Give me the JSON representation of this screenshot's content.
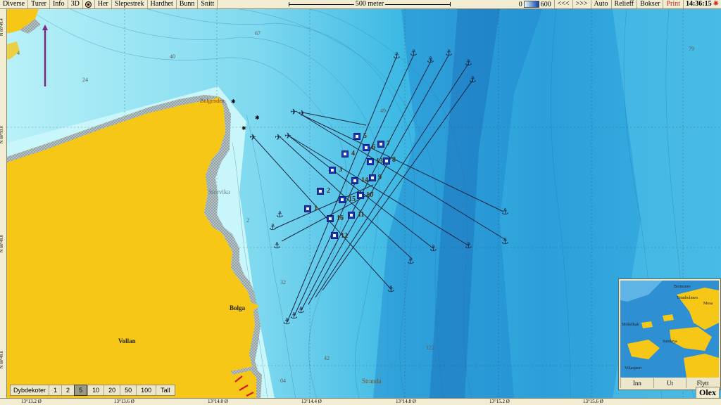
{
  "menu": {
    "items": [
      "Diverse",
      "Turer",
      "Info",
      "3D",
      "Her",
      "Slepestrek",
      "Hardhet",
      "Bunn",
      "Snitt"
    ],
    "scale_label": "500 meter",
    "depth_min": "0",
    "depth_max": "600",
    "nav_left": "<<<",
    "nav_right": ">>>",
    "auto": "Auto",
    "relief": "Relieff",
    "boxes": "Bokser",
    "print": "Print",
    "clock": "14:36:15"
  },
  "map": {
    "places": {
      "bolgenden": "Bolgenden",
      "storvika": "Storvika",
      "bolga": "Bolga",
      "vollan": "Vollan",
      "stranda": "Stranda"
    },
    "depth_labels": [
      "67",
      "40",
      "24",
      "49",
      "79",
      "2",
      "32",
      "42",
      "122",
      "4",
      "04"
    ],
    "stations": [
      "1",
      "2",
      "3",
      "4",
      "5",
      "6",
      "7",
      "8",
      "9",
      "10",
      "11",
      "12",
      "13",
      "14",
      "15",
      "16"
    ]
  },
  "latitudes": [
    "N 66°50.0",
    "N 66°49.8",
    "N 66°49.6",
    "N 66°49.4"
  ],
  "longitudes": [
    "13°13.2 Ø",
    "13°13.6 Ø",
    "13°14.0 Ø",
    "13°14.4 Ø",
    "13°14.8 Ø",
    "13°15.2 Ø",
    "13°15.6 Ø"
  ],
  "depth_bar": {
    "title": "Dybdekoter",
    "options": [
      "1",
      "2",
      "5",
      "10",
      "20",
      "50",
      "100",
      "Tall"
    ],
    "selected": "5"
  },
  "minimap": {
    "buttons": [
      "Inn",
      "Ut",
      "Flytt"
    ],
    "labels": [
      "Bremsnes",
      "Tennholmen",
      "Mosa",
      "Mokelbak",
      "Sandøya",
      "Vikasjøen"
    ]
  },
  "brand": "Olex",
  "colors": {
    "land": "#f7c718",
    "shallow": "#a8ecf7",
    "deep": "#1a78c9",
    "track": "#1a2440"
  }
}
